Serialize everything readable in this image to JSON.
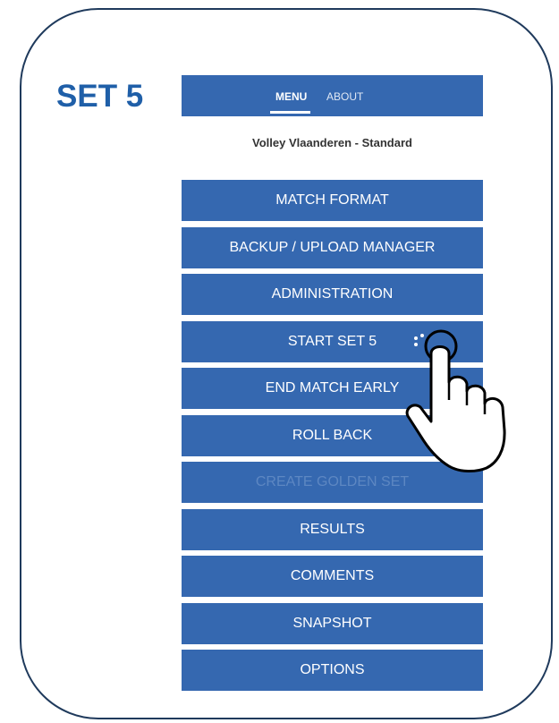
{
  "heading": "SET 5",
  "tabs": {
    "menu": "MENU",
    "about": "ABOUT"
  },
  "subtitle": "Volley Vlaanderen - Standard",
  "menu_items": [
    {
      "label": "MATCH FORMAT",
      "enabled": true
    },
    {
      "label": "BACKUP / UPLOAD MANAGER",
      "enabled": true
    },
    {
      "label": "ADMINISTRATION",
      "enabled": true
    },
    {
      "label": "START SET 5",
      "enabled": true
    },
    {
      "label": "END MATCH EARLY",
      "enabled": true
    },
    {
      "label": "ROLL BACK",
      "enabled": true
    },
    {
      "label": "CREATE GOLDEN SET",
      "enabled": false
    },
    {
      "label": "RESULTS",
      "enabled": true
    },
    {
      "label": "COMMENTS",
      "enabled": true
    },
    {
      "label": "SNAPSHOT",
      "enabled": true
    },
    {
      "label": "OPTIONS",
      "enabled": true
    }
  ],
  "colors": {
    "primary": "#3568b0",
    "heading": "#1f5fa8",
    "disabled_text": "#5d87c2"
  },
  "icons": {
    "pointer": "tap-hand-icon"
  }
}
